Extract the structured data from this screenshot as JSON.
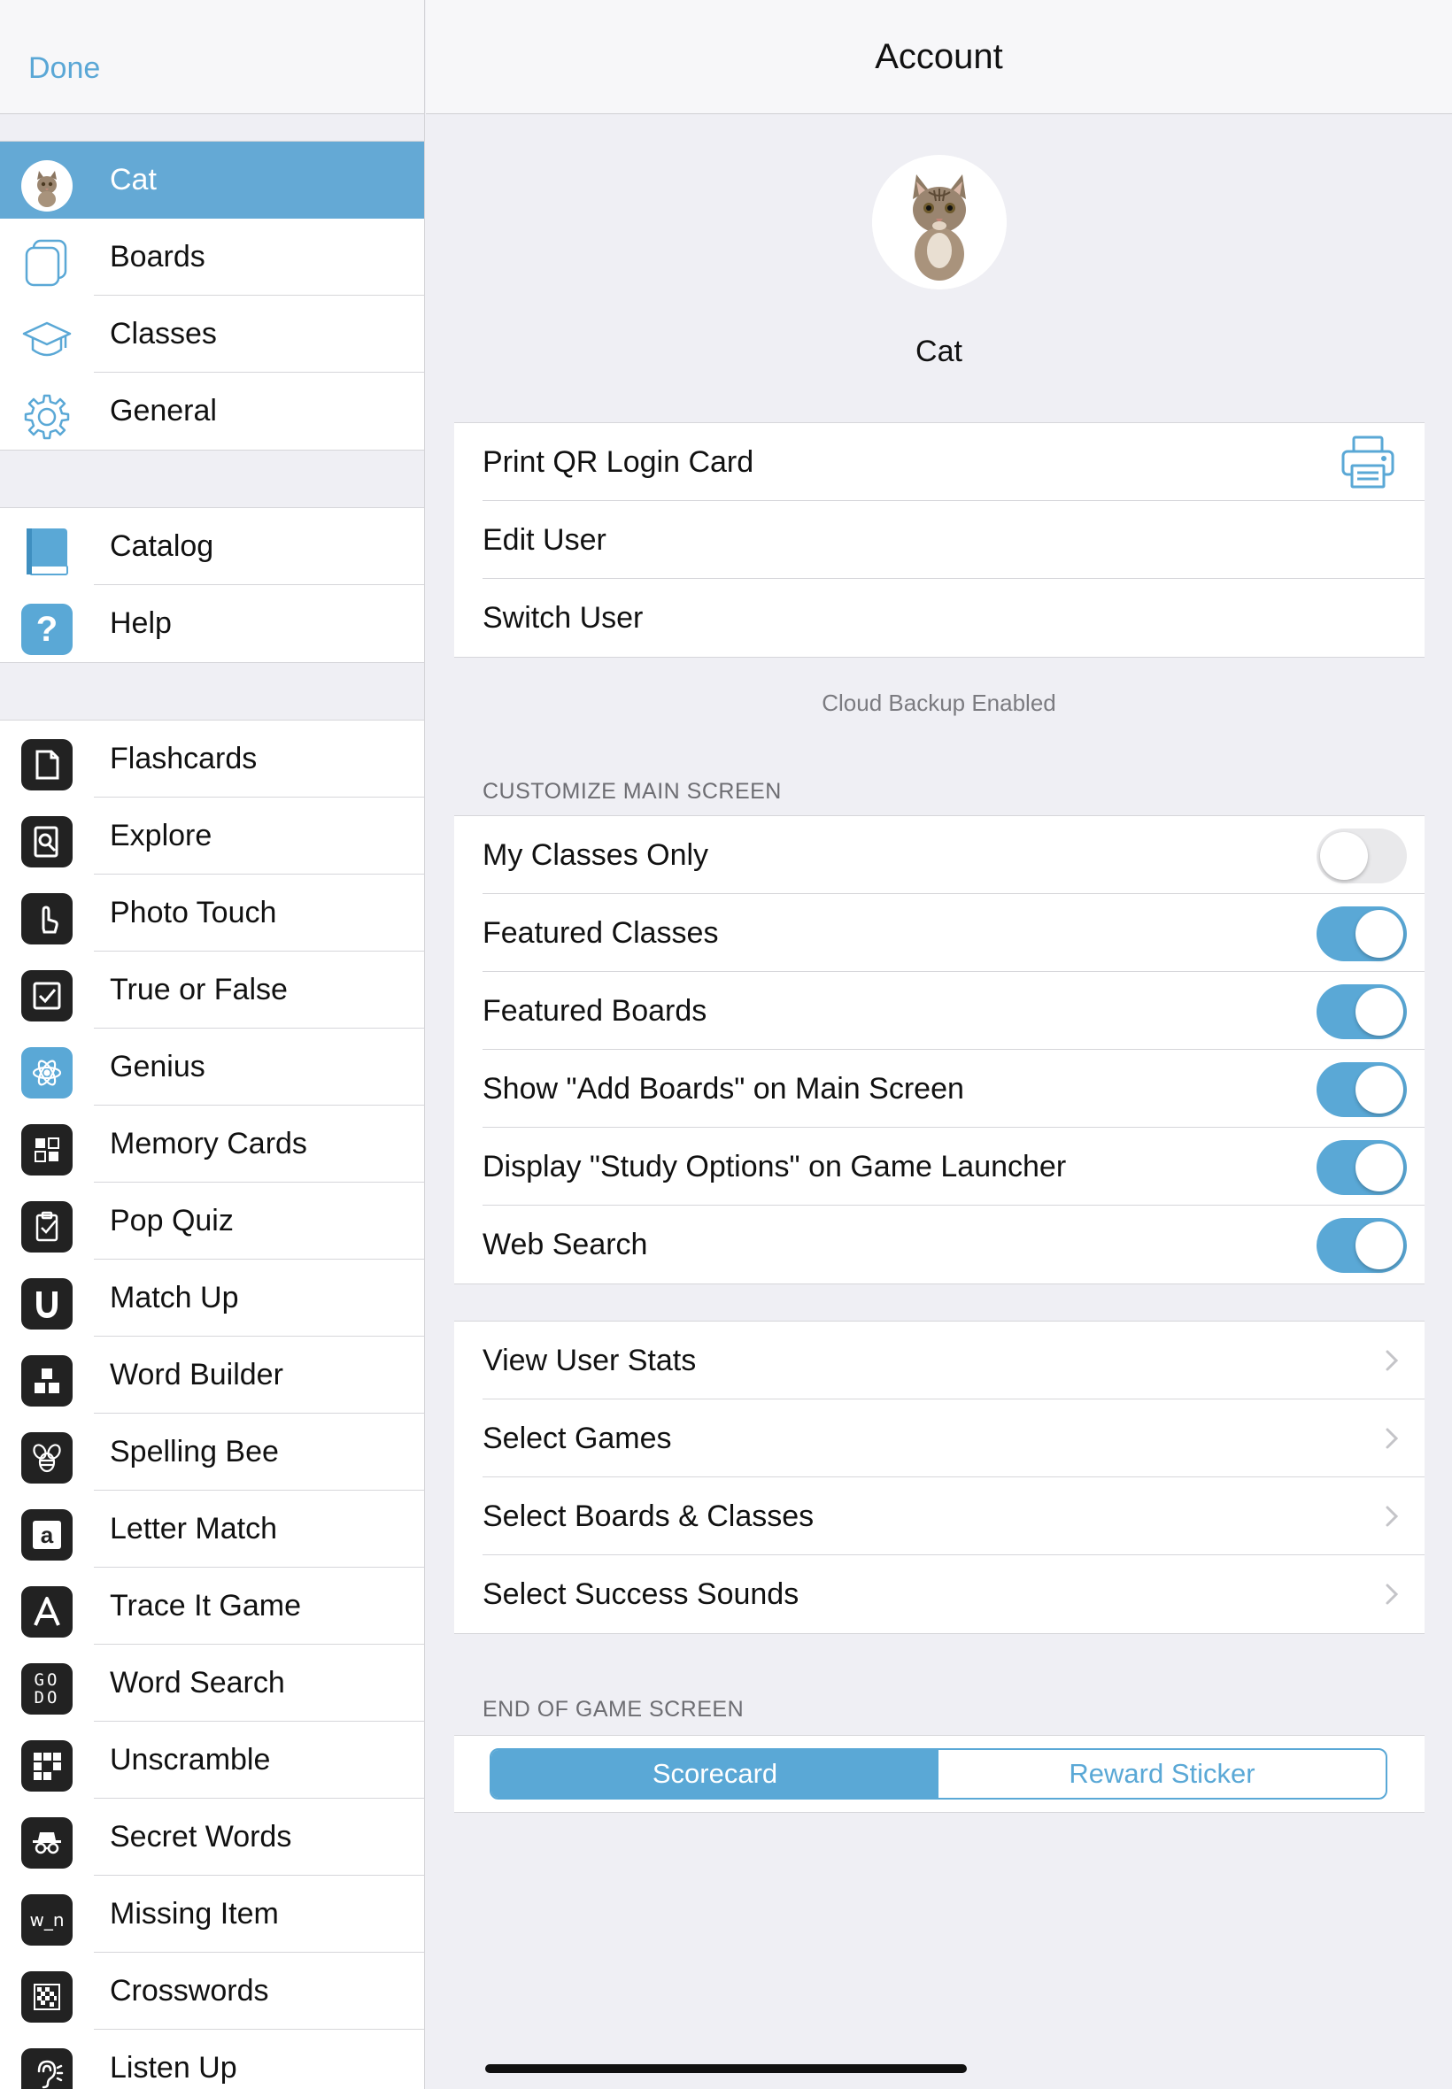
{
  "sidebar": {
    "done_label": "Done",
    "user": {
      "name": "Cat"
    },
    "settings_items": [
      {
        "label": "Boards",
        "icon": "boards-icon"
      },
      {
        "label": "Classes",
        "icon": "graduation-cap-icon"
      },
      {
        "label": "General",
        "icon": "gear-icon"
      }
    ],
    "resource_items": [
      {
        "label": "Catalog",
        "icon": "book-icon"
      },
      {
        "label": "Help",
        "icon": "question-icon"
      }
    ],
    "games": [
      {
        "label": "Flashcards",
        "icon": "flashcard-icon"
      },
      {
        "label": "Explore",
        "icon": "magnifier-icon"
      },
      {
        "label": "Photo Touch",
        "icon": "touch-hand-icon"
      },
      {
        "label": "True or False",
        "icon": "checkbox-icon"
      },
      {
        "label": "Genius",
        "icon": "atom-icon"
      },
      {
        "label": "Memory Cards",
        "icon": "memory-grid-icon"
      },
      {
        "label": "Pop Quiz",
        "icon": "clipboard-icon"
      },
      {
        "label": "Match Up",
        "icon": "magnet-icon"
      },
      {
        "label": "Word Builder",
        "icon": "blocks-icon"
      },
      {
        "label": "Spelling Bee",
        "icon": "bee-icon"
      },
      {
        "label": "Letter Match",
        "icon": "letter-a-icon"
      },
      {
        "label": "Trace It Game",
        "icon": "trace-a-icon"
      },
      {
        "label": "Word Search",
        "icon": "go-do-icon",
        "glyph": "GO DO"
      },
      {
        "label": "Unscramble",
        "icon": "unscramble-grid-icon"
      },
      {
        "label": "Secret Words",
        "icon": "spy-icon"
      },
      {
        "label": "Missing Item",
        "icon": "missing-letter-icon",
        "glyph": "w_n"
      },
      {
        "label": "Crosswords",
        "icon": "crossword-icon"
      },
      {
        "label": "Listen Up",
        "icon": "ear-icon"
      }
    ]
  },
  "main": {
    "title": "Account",
    "user_name": "Cat",
    "account_actions": [
      {
        "label": "Print QR Login Card",
        "icon": "printer-icon"
      },
      {
        "label": "Edit User"
      },
      {
        "label": "Switch User"
      }
    ],
    "backup_note": "Cloud Backup Enabled",
    "customize_header": "CUSTOMIZE MAIN SCREEN",
    "toggles": [
      {
        "label": "My Classes Only",
        "on": false
      },
      {
        "label": "Featured Classes",
        "on": true
      },
      {
        "label": "Featured Boards",
        "on": true
      },
      {
        "label": "Show \"Add Boards\" on Main Screen",
        "on": true
      },
      {
        "label": "Display \"Study Options\" on Game Launcher",
        "on": true
      },
      {
        "label": "Web Search",
        "on": true
      }
    ],
    "nav_rows": [
      {
        "label": "View User Stats"
      },
      {
        "label": "Select Games"
      },
      {
        "label": "Select Boards & Classes"
      },
      {
        "label": "Select Success Sounds"
      }
    ],
    "end_header": "END OF GAME SCREEN",
    "end_options": [
      {
        "label": "Scorecard",
        "selected": true
      },
      {
        "label": "Reward Sticker",
        "selected": false
      }
    ]
  },
  "colors": {
    "accent": "#5aa8d6",
    "selected_row": "#64a9d5",
    "background": "#efeff4"
  }
}
